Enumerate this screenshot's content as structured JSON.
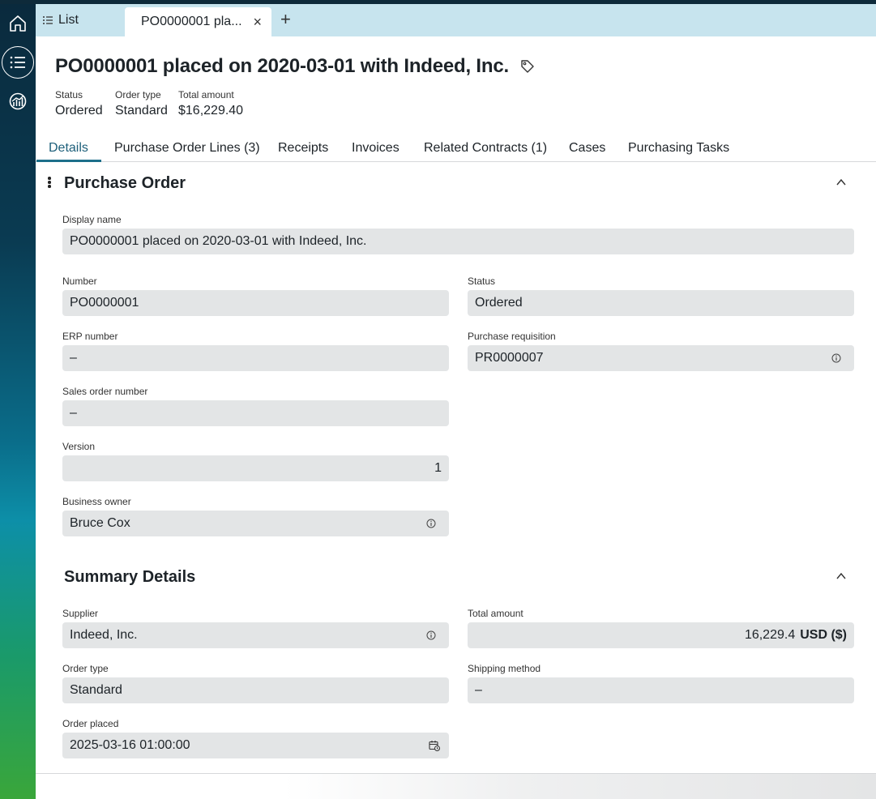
{
  "app": {
    "rail": [
      {
        "icon": "home-icon",
        "label": "Home"
      },
      {
        "icon": "list-icon",
        "label": "List",
        "active": true
      },
      {
        "icon": "analytics-icon",
        "label": "Analytics"
      }
    ]
  },
  "tabbar": {
    "list_label": "List",
    "active_tab": "PO0000001 pla...",
    "close_glyph": "×",
    "add_glyph": "+"
  },
  "header": {
    "title": "PO0000001 placed on 2020-03-01 with Indeed, Inc.",
    "status_label": "Status",
    "status_value": "Ordered",
    "order_type_label": "Order type",
    "order_type_value": "Standard",
    "total_label": "Total amount",
    "total_value": "$16,229.40"
  },
  "tabs": [
    {
      "label": "Details",
      "active": true
    },
    {
      "label": "Purchase Order Lines (3)"
    },
    {
      "label": "Receipts"
    },
    {
      "label": "Invoices"
    },
    {
      "label": "Related Contracts (1)"
    },
    {
      "label": "Cases"
    },
    {
      "label": "Purchasing Tasks"
    }
  ],
  "purchase_order": {
    "title": "Purchase Order",
    "display_name_label": "Display name",
    "display_name": "PO0000001 placed on 2020-03-01 with Indeed, Inc.",
    "number_label": "Number",
    "number": "PO0000001",
    "status_label": "Status",
    "status": "Ordered",
    "erp_label": "ERP number",
    "erp": "–",
    "requisition_label": "Purchase requisition",
    "requisition": "PR0000007",
    "sales_order_label": "Sales order number",
    "sales_order": "–",
    "version_label": "Version",
    "version": "1",
    "owner_label": "Business owner",
    "owner": "Bruce Cox"
  },
  "summary": {
    "title": "Summary Details",
    "supplier_label": "Supplier",
    "supplier": "Indeed, Inc.",
    "total_label": "Total amount",
    "total_value": "16,229.4",
    "total_unit": "USD ($)",
    "order_type_label": "Order type",
    "order_type": "Standard",
    "shipping_label": "Shipping method",
    "shipping": "–",
    "placed_label": "Order placed",
    "placed": "2025-03-16 01:00:00"
  },
  "colors": {
    "tabbar_bg": "#c7e4ee",
    "field_bg": "#e3e5e6",
    "accent": "#1d6f8a"
  }
}
